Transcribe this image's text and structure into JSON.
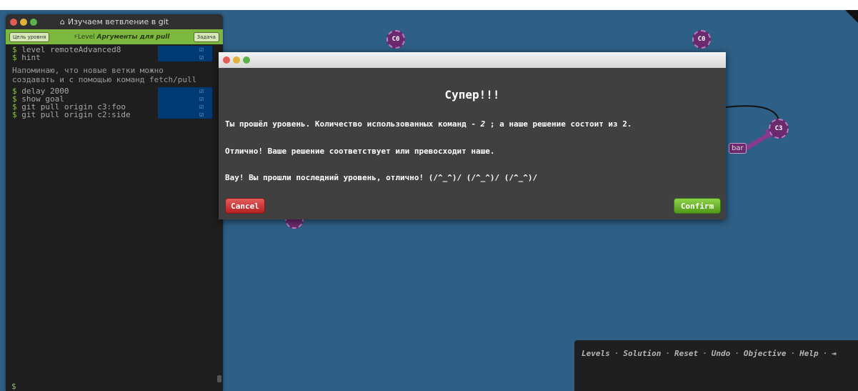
{
  "terminal": {
    "title": "Изучаем ветвление в git",
    "goal_button": "Цель уровня",
    "level_prefix": "Level",
    "level_name": "Аргументы для pull",
    "task_button": "Задача",
    "commands_a": [
      "level remoteAdvanced8",
      "hint"
    ],
    "note_line1": "Напоминаю, что новые ветки можно",
    "note_line2": "создавать и с помощью команд fetch/pull",
    "commands_b": [
      "delay 2000",
      "show goal",
      "git pull origin c3:foo",
      "git pull origin c2:side"
    ],
    "prompt": "$"
  },
  "canvas": {
    "nodes": {
      "c0_left": "C0",
      "c0_right": "C0",
      "c3": "C3"
    },
    "branch_bar": "bar"
  },
  "modal": {
    "heading": "Супер!!!",
    "line1_pre": "Ты прошёл уровень. Количество использованных команд - ",
    "line1_count": "2",
    "line1_post": " ; а наше решение состоит из 2.",
    "line2": "Отлично! Ваше решение соответствует или превосходит наше.",
    "line3": "Вау! Вы прошли последний уровень, отлично! (/^_^)/ (/^_^)/ (/^_^)/",
    "cancel": "Cancel",
    "confirm": "Confirm"
  },
  "command_panel": {
    "links": [
      "Levels",
      "Solution",
      "Reset",
      "Undo",
      "Objective",
      "Help"
    ],
    "separator": "·"
  },
  "colors": {
    "canvas": "#2e5f86",
    "commit": "#6b2a6e",
    "level_bar": "#7cb83d",
    "done_highlight": "#003a74"
  }
}
